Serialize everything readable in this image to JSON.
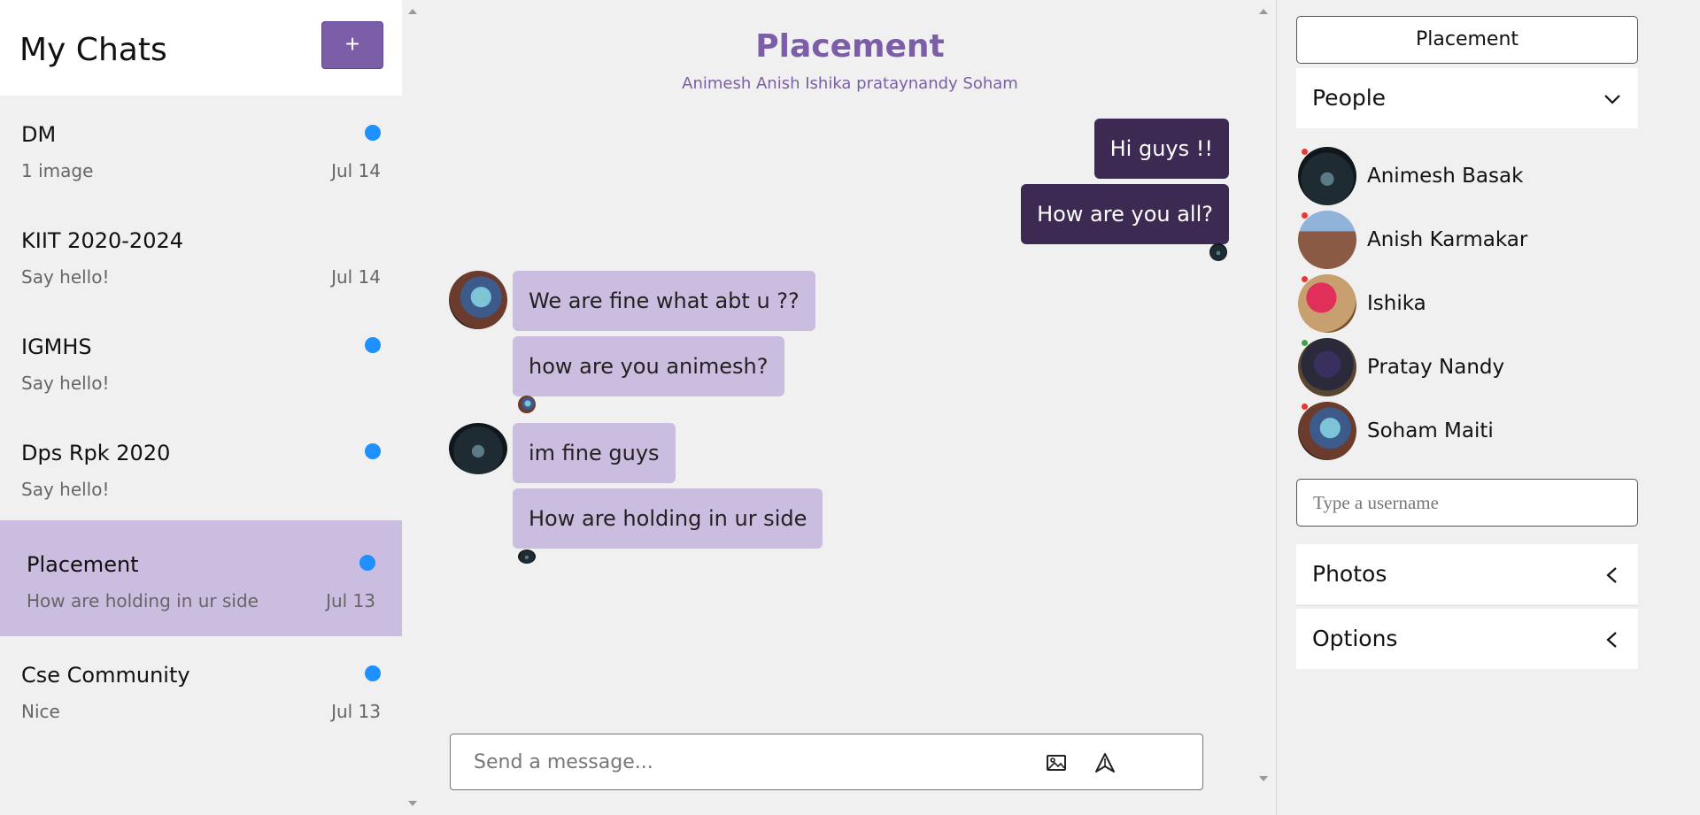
{
  "sidebar": {
    "title": "My Chats",
    "new_chat_label": "+",
    "chats": [
      {
        "name": "DM",
        "preview": "1 image",
        "date": "Jul 14",
        "unread": true
      },
      {
        "name": "KIIT 2020-2024",
        "preview": "Say hello!",
        "date": "Jul 14",
        "unread": false
      },
      {
        "name": "IGMHS",
        "preview": "Say hello!",
        "date": "",
        "unread": true
      },
      {
        "name": "Dps Rpk 2020",
        "preview": "Say hello!",
        "date": "",
        "unread": true
      },
      {
        "name": "Placement",
        "preview": "How are holding in ur side",
        "date": "Jul 13",
        "unread": true,
        "active": true
      },
      {
        "name": "Cse Community",
        "preview": "Nice",
        "date": "Jul 13",
        "unread": true
      }
    ]
  },
  "chat": {
    "title": "Placement",
    "members": "Animesh Anish Ishika prataynandy Soham",
    "messages": [
      {
        "text": "Hi guys !!",
        "direction": "out"
      },
      {
        "text": "How are you all?",
        "direction": "out"
      },
      {
        "text": "We are fine what abt u ??",
        "direction": "in",
        "sender_avatar": "soham-avatar"
      },
      {
        "text": "how are you animesh?",
        "direction": "in"
      },
      {
        "text": "im fine guys",
        "direction": "in",
        "sender_avatar": "animesh-avatar"
      },
      {
        "text": "How are holding in ur side",
        "direction": "in"
      }
    ],
    "composer_placeholder": "Send a message...",
    "attach_icon": "image-icon",
    "send_icon": "send-icon"
  },
  "info": {
    "group_name": "Placement",
    "people_label": "People",
    "people": [
      {
        "name": "Animesh Basak",
        "status_color": "#e53935"
      },
      {
        "name": "Anish Karmakar",
        "status_color": "#e53935"
      },
      {
        "name": "Ishika",
        "status_color": "#e53935"
      },
      {
        "name": "Pratay Nandy",
        "status_color": "#43a047"
      },
      {
        "name": "Soham Maiti",
        "status_color": "#e53935"
      }
    ],
    "username_placeholder": "Type a username",
    "photos_label": "Photos",
    "options_label": "Options"
  },
  "colors": {
    "accent": "#7b5ea7",
    "outgoing_bubble": "#3d2a52",
    "incoming_bubble": "#cbbde0",
    "unread_dot": "#1e90ff"
  }
}
